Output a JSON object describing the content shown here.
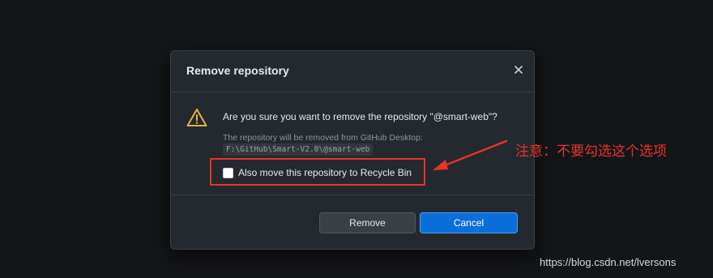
{
  "dialog": {
    "title": "Remove repository",
    "question": "Are you sure you want to remove the repository \"@smart-web\"?",
    "removed_note": "The repository will be removed from GitHub Desktop:",
    "path": "F:\\GitHub\\Smart-V2.0\\@smart-web",
    "checkbox_label": "Also move this repository to Recycle Bin",
    "checkbox_checked": false,
    "remove_label": "Remove",
    "cancel_label": "Cancel",
    "icons": {
      "close": "close-icon",
      "warning": "warning-icon"
    }
  },
  "annotation": {
    "text": "注意：不要勾选这个选项"
  },
  "watermark": "https://blog.csdn.net/lversons",
  "colors": {
    "background": "#141518",
    "dialog_bg": "#24292f",
    "primary_button": "#0a6fdb",
    "secondary_button": "#3a3f46",
    "warning": "#e3b341",
    "annotation_red": "#e8332a"
  }
}
